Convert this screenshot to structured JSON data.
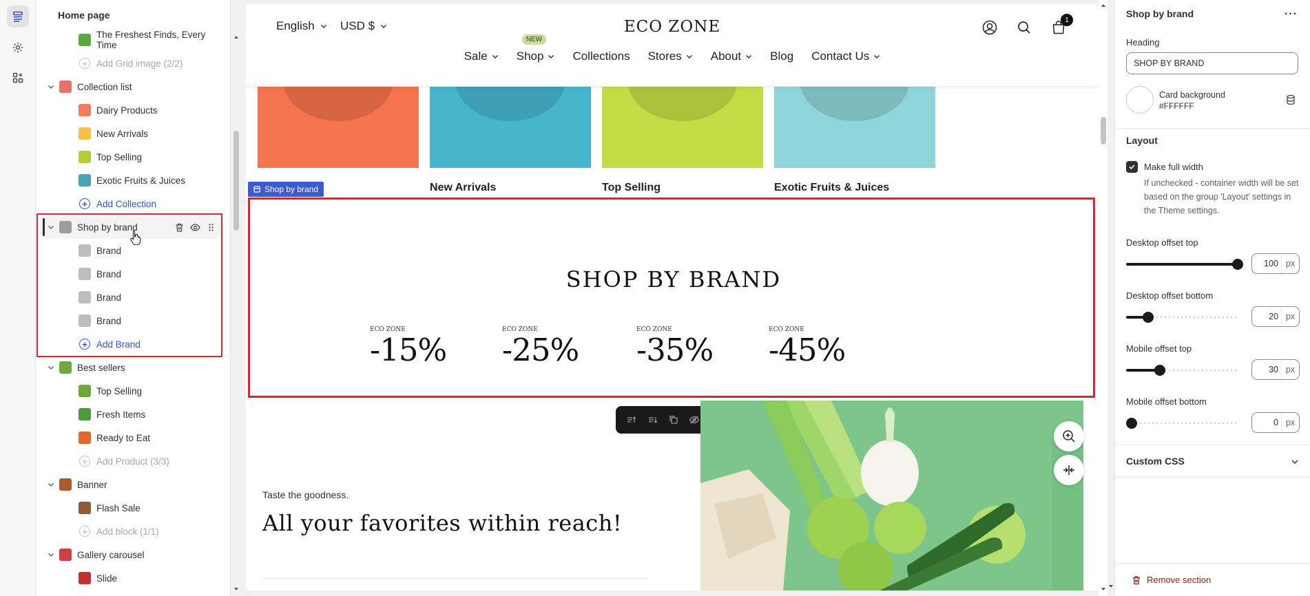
{
  "tree": {
    "title": "Home page",
    "rows": [
      {
        "kind": "blk",
        "label": "The Freshest Finds, Every Time",
        "icon": "image-thumb-icon",
        "color": "#5fa840"
      },
      {
        "kind": "add-dis",
        "label": "Add Grid image (2/2)"
      },
      {
        "kind": "sec",
        "label": "Collection list",
        "icon": "collection-list-icon",
        "color": "#e8716a"
      },
      {
        "kind": "blk",
        "label": "Dairy Products",
        "icon": "collection-thumb-icon",
        "color": "#f07c60"
      },
      {
        "kind": "blk",
        "label": "New Arrivals",
        "icon": "collection-thumb-icon",
        "color": "#f5c14d"
      },
      {
        "kind": "blk",
        "label": "Top Selling",
        "icon": "collection-thumb-icon",
        "color": "#b8cc3a"
      },
      {
        "kind": "blk",
        "label": "Exotic Fruits & Juices",
        "icon": "collection-thumb-icon",
        "color": "#4aa3b5"
      },
      {
        "kind": "add",
        "label": "Add Collection"
      },
      {
        "kind": "sec-selected",
        "label": "Shop by brand",
        "icon": "brand-section-icon",
        "color": "#9c9c9c"
      },
      {
        "kind": "blk",
        "label": "Brand",
        "icon": "brand-logo-icon",
        "color": "#bdbdbd"
      },
      {
        "kind": "blk",
        "label": "Brand",
        "icon": "brand-logo-icon",
        "color": "#bdbdbd"
      },
      {
        "kind": "blk",
        "label": "Brand",
        "icon": "brand-logo-icon",
        "color": "#bdbdbd"
      },
      {
        "kind": "blk",
        "label": "Brand",
        "icon": "brand-logo-icon",
        "color": "#bdbdbd"
      },
      {
        "kind": "add",
        "label": "Add Brand"
      },
      {
        "kind": "sec",
        "label": "Best sellers",
        "icon": "product-section-icon",
        "color": "#6da83a"
      },
      {
        "kind": "blk",
        "label": "Top Selling",
        "icon": "product-thumb-icon",
        "color": "#6da83a"
      },
      {
        "kind": "blk",
        "label": "Fresh Items",
        "icon": "product-thumb-icon",
        "color": "#4c9a3a"
      },
      {
        "kind": "blk",
        "label": "Ready to Eat",
        "icon": "product-thumb-icon",
        "color": "#e0662e"
      },
      {
        "kind": "add-dis",
        "label": "Add Product (3/3)"
      },
      {
        "kind": "sec",
        "label": "Banner",
        "icon": "banner-section-icon",
        "color": "#a85a30"
      },
      {
        "kind": "blk",
        "label": "Flash Sale",
        "icon": "banner-thumb-icon",
        "color": "#8f5a36"
      },
      {
        "kind": "add-dis",
        "label": "Add block (1/1)"
      },
      {
        "kind": "sec",
        "label": "Gallery carousel",
        "icon": "gallery-section-icon",
        "color": "#d14040"
      },
      {
        "kind": "blk",
        "label": "Slide",
        "icon": "slide-thumb-icon",
        "color": "#c43030"
      }
    ]
  },
  "store": {
    "language": "English",
    "currency": "USD $",
    "logo": "ECO ZONE",
    "cart_count": "1",
    "nav": [
      {
        "label": "Sale",
        "dropdown": true
      },
      {
        "label": "Shop",
        "dropdown": true,
        "badge": "NEW"
      },
      {
        "label": "Collections",
        "dropdown": false
      },
      {
        "label": "Stores",
        "dropdown": true
      },
      {
        "label": "About",
        "dropdown": true
      },
      {
        "label": "Blog",
        "dropdown": false
      },
      {
        "label": "Contact Us",
        "dropdown": true
      }
    ],
    "collections": [
      {
        "label": "cts",
        "color": "#f5734e"
      },
      {
        "label": "New Arrivals",
        "color": "#46b5cc"
      },
      {
        "label": "Top Selling",
        "color": "#c3dc45"
      },
      {
        "label": "Exotic Fruits & Juices",
        "color": "#8fd4d8"
      }
    ],
    "section_tag": "Shop by brand",
    "brand_title": "SHOP BY BRAND",
    "brands": [
      {
        "label": "ECO ZONE",
        "percent": "-15%"
      },
      {
        "label": "ECO ZONE",
        "percent": "-25%"
      },
      {
        "label": "ECO ZONE",
        "percent": "-35%"
      },
      {
        "label": "ECO ZONE",
        "percent": "-45%"
      }
    ],
    "tagline_small": "Taste the goodness.",
    "tagline_big": "All your favorites within reach!"
  },
  "settings": {
    "title": "Shop by brand",
    "heading_label": "Heading",
    "heading_value": "SHOP BY BRAND",
    "card_bg_label": "Card background",
    "card_bg_value": "#FFFFFF",
    "layout_label": "Layout",
    "full_width_label": "Make full width",
    "full_width_checked": true,
    "full_width_help": "If unchecked - container width will be set based on the group 'Layout' settings in the Theme settings.",
    "sliders": [
      {
        "label": "Desktop offset top",
        "value": "100",
        "unit": "px",
        "fraction": 1.0
      },
      {
        "label": "Desktop offset bottom",
        "value": "20",
        "unit": "px",
        "fraction": 0.2
      },
      {
        "label": "Mobile offset top",
        "value": "30",
        "unit": "px",
        "fraction": 0.3
      },
      {
        "label": "Mobile offset bottom",
        "value": "0",
        "unit": "px",
        "fraction": 0.0
      }
    ],
    "custom_css_label": "Custom CSS",
    "remove_label": "Remove section"
  },
  "colors": {
    "accent_blue": "#2c54d6",
    "selection_red": "#e0222f",
    "remove_red": "#8e1f0b"
  }
}
